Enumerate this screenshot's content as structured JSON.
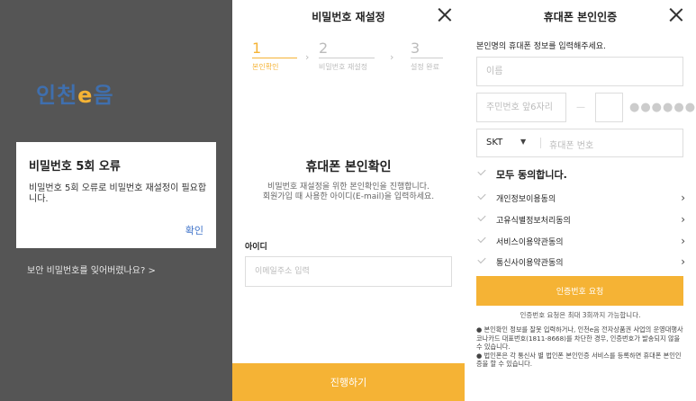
{
  "panel1": {
    "logo_main": "인천",
    "logo_e": "e",
    "logo_end": "음",
    "forgot_link": "보안 비밀번호를 잊어버렸나요? >",
    "dialog": {
      "title": "비밀번호 5회 오류",
      "message": "비밀번호 5회 오류로 비밀번호 재설정이 필요합니다.",
      "confirm": "확인"
    }
  },
  "panel2": {
    "title": "비밀번호 재설정",
    "steps": [
      {
        "num": "1",
        "label": "본인확인"
      },
      {
        "num": "2",
        "label": "비밀번호 재설정"
      },
      {
        "num": "3",
        "label": "설정 완료"
      }
    ],
    "heading": "휴대폰 본인확인",
    "desc_line1": "비밀번호 재설정을 위한 본인확인을 진행합니다.",
    "desc_line2": "회원가입 때 사용한 아이디(E-mail)을 입력하세요.",
    "id_label": "아이디",
    "id_placeholder": "이메일주소 입력",
    "submit": "진행하기"
  },
  "panel3": {
    "title": "휴대폰 본인인증",
    "intro": "본인명의 휴대폰 정보를 입력해주세요.",
    "name_placeholder": "이름",
    "rrn_placeholder": "주민번호 앞6자리",
    "rrn_dash": "—",
    "rrn_mask": "●●●●●●",
    "carrier": "SKT",
    "phone_placeholder": "휴대폰 번호",
    "agree_all": "모두 동의합니다.",
    "agreements": [
      "개인정보이용동의",
      "고유식별정보처리동의",
      "서비스이용약관동의",
      "통신사이용약관동의"
    ],
    "request_button": "인증번호 요청",
    "request_note": "인증번호 요청은 최대 3회까지 가능합니다.",
    "notice1": "● 본인확인 정보를 잘못 입력하거나, 인천e음 전자상품권 사업의 운영대행사 코나카드 대표번호(1811-8668)를 차단한 경우, 인증번호가 발송되지 않을 수 있습니다.",
    "notice2": "● 법인폰은 각 통신사 별 법인폰 본인인증 서비스를 등록하면 휴대폰 본인인증을 할 수 있습니다."
  }
}
